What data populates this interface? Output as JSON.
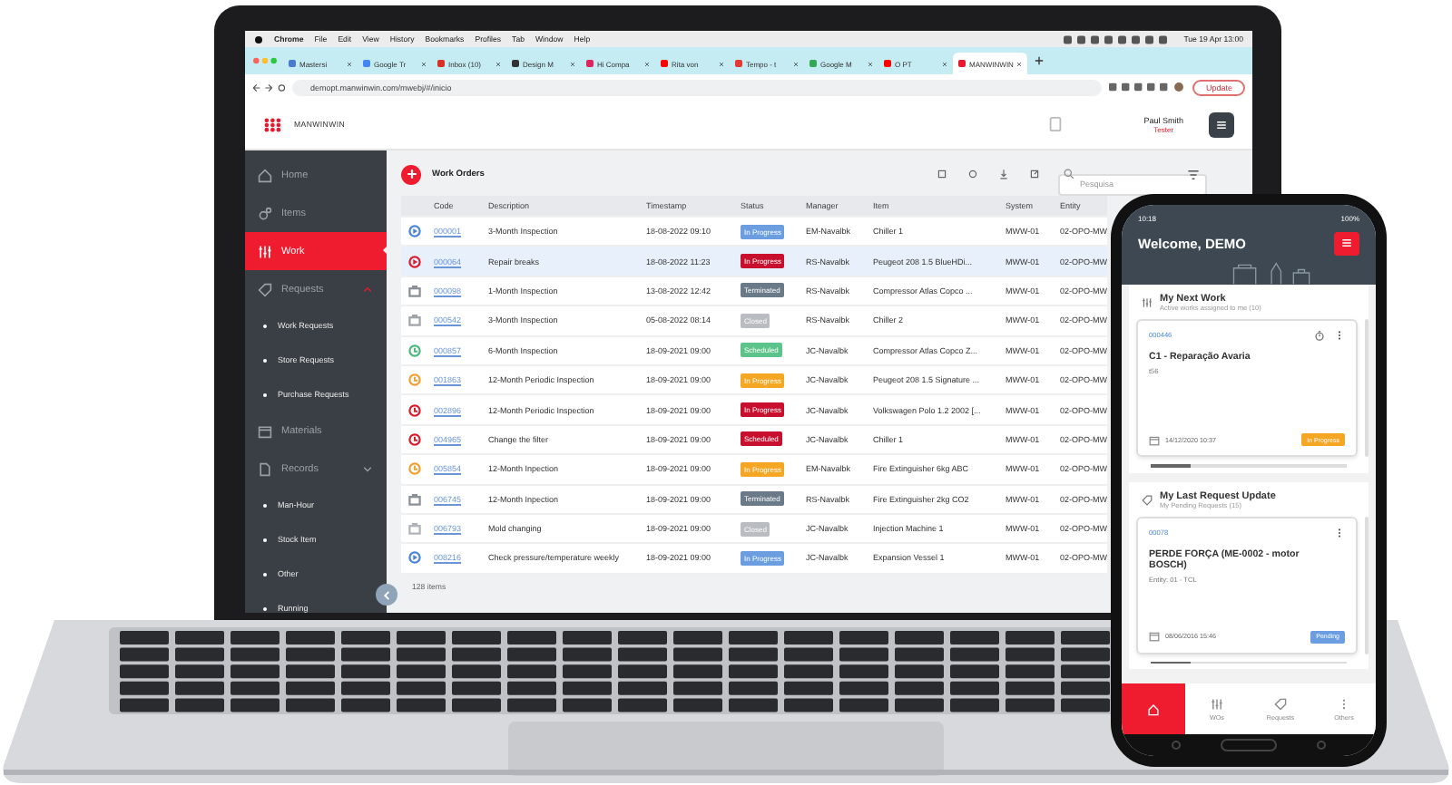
{
  "menu_bar": {
    "app": "Chrome",
    "items": [
      "File",
      "Edit",
      "View",
      "History",
      "Bookmarks",
      "Profiles",
      "Tab",
      "Window",
      "Help"
    ],
    "clock": "Tue 19 Apr 13:00"
  },
  "browser": {
    "tabs": [
      {
        "label": "Mastersi",
        "color": "#4a7bd0",
        "selected": false
      },
      {
        "label": "Google Tr",
        "color": "#4285f4",
        "selected": false
      },
      {
        "label": "Inbox (10)",
        "color": "#d93025",
        "selected": false
      },
      {
        "label": "Design M",
        "color": "#333333",
        "selected": false
      },
      {
        "label": "Hi Compa",
        "color": "#e0245e",
        "selected": false
      },
      {
        "label": "Rita von",
        "color": "#ff0000",
        "selected": false
      },
      {
        "label": "Tempo - t",
        "color": "#e53935",
        "selected": false
      },
      {
        "label": "Google M",
        "color": "#34a853",
        "selected": false
      },
      {
        "label": "O PT",
        "color": "#ff0000",
        "selected": false
      },
      {
        "label": "MANWINWIN",
        "color": "#e8192c",
        "selected": true
      }
    ],
    "address": "demopt.manwinwin.com/mwebj/#/inicio",
    "update_button": "Update"
  },
  "app_header": {
    "logo": "MANWINWIN",
    "user_name": "Paul Smith",
    "user_role": "Tester"
  },
  "sidebar": {
    "items": [
      {
        "label": "Home",
        "kind": "home",
        "selected": false
      },
      {
        "label": "Items",
        "kind": "gears",
        "selected": false
      },
      {
        "label": "Work",
        "kind": "tools",
        "selected": true
      },
      {
        "label": "Requests",
        "kind": "tag",
        "selected": false,
        "expanded": true,
        "children": [
          {
            "label": "Work Requests"
          },
          {
            "label": "Store Requests"
          },
          {
            "label": "Purchase Requests"
          }
        ]
      },
      {
        "label": "Materials",
        "kind": "box",
        "selected": false
      },
      {
        "label": "Records",
        "kind": "folder",
        "selected": false,
        "expanded": true,
        "children": [
          {
            "label": "Man-Hour"
          },
          {
            "label": "Stock Item"
          },
          {
            "label": "Other"
          },
          {
            "label": "Running"
          }
        ]
      }
    ]
  },
  "work_orders": {
    "title": "Work Orders",
    "search": {
      "placeholder": "Pesquisa"
    },
    "columns": [
      "Code",
      "Description",
      "Timestamp",
      "Status",
      "Manager",
      "Item",
      "System",
      "Entity"
    ],
    "rows": [
      {
        "selected": false,
        "icon": {
          "kind": "play",
          "color": "#4a86d8"
        },
        "code": "000001",
        "description": "3-Month Inspection",
        "timestamp": "18-08-2022 09:10",
        "status": {
          "label": "In Progress",
          "color": "#6a9ee0"
        },
        "manager": "EM-Navalbk",
        "item": "Chiller 1",
        "system": "MWW-01",
        "entity": "02-OPO-MW"
      },
      {
        "selected": true,
        "icon": {
          "kind": "play",
          "color": "#d81e2c"
        },
        "code": "000064",
        "description": "Repair breaks",
        "timestamp": "18-08-2022 11:23",
        "status": {
          "label": "In Progress",
          "color": "#c8102e"
        },
        "manager": "RS-Navalbk",
        "item": "Peugeot 208 1.5 BlueHDi...",
        "system": "MWW-01",
        "entity": "02-OPO-MW"
      },
      {
        "selected": false,
        "icon": {
          "kind": "briefcase",
          "color": "#8a8f96"
        },
        "code": "000098",
        "description": "1-Month Inspection",
        "timestamp": "13-08-2022 12:42",
        "status": {
          "label": "Terminated",
          "color": "#6b7a88"
        },
        "manager": "RS-Navalbk",
        "item": "Compressor Atlas Copco ...",
        "system": "MWW-01",
        "entity": "02-OPO-MW"
      },
      {
        "selected": false,
        "icon": {
          "kind": "briefcase",
          "color": "#a0a4aa"
        },
        "code": "000542",
        "description": "3-Month Inspection",
        "timestamp": "05-08-2022 08:14",
        "status": {
          "label": "Closed",
          "color": "#b9bcc0"
        },
        "manager": "RS-Navalbk",
        "item": "Chiller 2",
        "system": "MWW-01",
        "entity": "02-OPO-MW"
      },
      {
        "selected": false,
        "icon": {
          "kind": "clock",
          "color": "#4cb87a"
        },
        "code": "000857",
        "description": "6-Month Inspection",
        "timestamp": "18-09-2021 09:00",
        "status": {
          "label": "Scheduled",
          "color": "#5cc48a"
        },
        "manager": "JC-Navalbk",
        "item": "Compressor Atlas Copco Z...",
        "system": "MWW-01",
        "entity": "02-OPO-MW"
      },
      {
        "selected": false,
        "icon": {
          "kind": "clock",
          "color": "#f0a030"
        },
        "code": "001863",
        "description": "12-Month Periodic Inspection",
        "timestamp": "18-09-2021 09:00",
        "status": {
          "label": "In Progress",
          "color": "#f5a623"
        },
        "manager": "JC-Navalbk",
        "item": "Peugeot 208 1.5 Signature ...",
        "system": "MWW-01",
        "entity": "02-OPO-MW"
      },
      {
        "selected": false,
        "icon": {
          "kind": "clock",
          "color": "#d81e2c"
        },
        "code": "002896",
        "description": "12-Month Periodic Inspection",
        "timestamp": "18-09-2021 09:00",
        "status": {
          "label": "In Progress",
          "color": "#c8102e"
        },
        "manager": "JC-Navalbk",
        "item": "Volkswagen Polo 1.2 2002 [...",
        "system": "MWW-01",
        "entity": "02-OPO-MW"
      },
      {
        "selected": false,
        "icon": {
          "kind": "clock",
          "color": "#d81e2c"
        },
        "code": "004965",
        "description": "Change the filter",
        "timestamp": "18-09-2021 09:00",
        "status": {
          "label": "Scheduled",
          "color": "#c8102e"
        },
        "manager": "JC-Navalbk",
        "item": "Chiller 1",
        "system": "MWW-01",
        "entity": "02-OPO-MW"
      },
      {
        "selected": false,
        "icon": {
          "kind": "clock",
          "color": "#f0a030"
        },
        "code": "005854",
        "description": "12-Month Inpection",
        "timestamp": "18-09-2021 09:00",
        "status": {
          "label": "In Progress",
          "color": "#f5a623"
        },
        "manager": "EM-Navalbk",
        "item": "Fire Extinguisher 6kg ABC",
        "system": "MWW-01",
        "entity": "02-OPO-MW"
      },
      {
        "selected": false,
        "icon": {
          "kind": "briefcase",
          "color": "#8a8f96"
        },
        "code": "006745",
        "description": "12-Month Inpection",
        "timestamp": "18-09-2021 09:00",
        "status": {
          "label": "Terminated",
          "color": "#6b7a88"
        },
        "manager": "RS-Navalbk",
        "item": "Fire Extinguisher 2kg CO2",
        "system": "MWW-01",
        "entity": "02-OPO-MW"
      },
      {
        "selected": false,
        "icon": {
          "kind": "briefcase",
          "color": "#b0b4b8"
        },
        "code": "006793",
        "description": "Mold changing",
        "timestamp": "18-09-2021 09:00",
        "status": {
          "label": "Closed",
          "color": "#b9bcc0"
        },
        "manager": "JC-Navalbk",
        "item": "Injection Machine 1",
        "system": "MWW-01",
        "entity": "02-OPO-MW"
      },
      {
        "selected": false,
        "icon": {
          "kind": "play",
          "color": "#4a86d8"
        },
        "code": "008216",
        "description": "Check pressure/temperature weekly",
        "timestamp": "18-09-2021 09:00",
        "status": {
          "label": "In Progress",
          "color": "#6a9ee0"
        },
        "manager": "JC-Navalbk",
        "item": "Expansion Vessel 1",
        "system": "MWW-01",
        "entity": "02-OPO-MW"
      }
    ],
    "footer": "128 items"
  },
  "phone": {
    "time": "10:18",
    "battery": "100%",
    "welcome": "Welcome, DEMO",
    "sections": [
      {
        "kind": "tools",
        "title": "My Next Work",
        "subtitle": "Active works assigned to me (10)",
        "card": {
          "code": "000446",
          "title": "C1 - Reparação Avaria",
          "subtitle": "t56",
          "date": "14/12/2020 10:37",
          "timer": true,
          "status": {
            "label": "In Progress",
            "color": "#f5a623"
          }
        }
      },
      {
        "kind": "tag",
        "title": "My Last Request Update",
        "subtitle": "My Pending Requests (15)",
        "card": {
          "code": "00078",
          "title": "PERDE FORÇA (ME-0002 - motor BOSCH)",
          "subtitle": "Entity: 01 - TCL",
          "date": "08/06/2016 15:46",
          "timer": false,
          "status": {
            "label": "Pending",
            "color": "#6a9ee0"
          }
        }
      }
    ],
    "nav": [
      {
        "kind": "home",
        "selected": true
      },
      {
        "kind": "tools",
        "label": "WOs",
        "selected": false
      },
      {
        "kind": "tag",
        "label": "Requests",
        "selected": false
      },
      {
        "kind": "dots",
        "label": "Others",
        "selected": false
      }
    ]
  }
}
